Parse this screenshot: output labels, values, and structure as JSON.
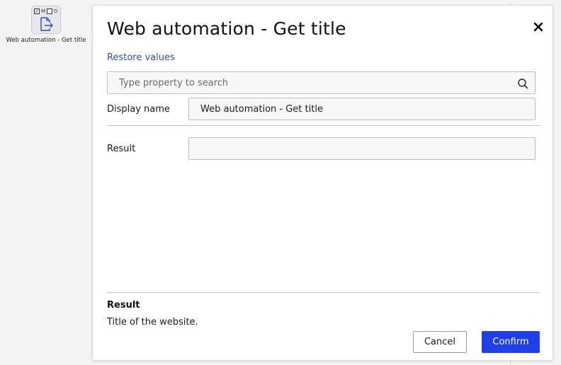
{
  "node": {
    "flag_m": "M",
    "flag_d": "D",
    "flag_m_checked": true,
    "flag_d_checked": false,
    "icon": "document-export-icon",
    "label": "Web automation - Get title"
  },
  "dialog": {
    "title": "Web automation - Get title",
    "restore_label": "Restore values",
    "search": {
      "placeholder": "Type property to search",
      "value": ""
    },
    "fields": {
      "display_name": {
        "label": "Display name",
        "value": "Web automation - Get title"
      },
      "result": {
        "label": "Result",
        "value": ""
      }
    },
    "info": {
      "title": "Result",
      "description": "Title of the website."
    },
    "buttons": {
      "cancel": "Cancel",
      "confirm": "Confirm"
    }
  },
  "colors": {
    "accent": "#1f3fe6",
    "link": "#2f4fb0"
  }
}
